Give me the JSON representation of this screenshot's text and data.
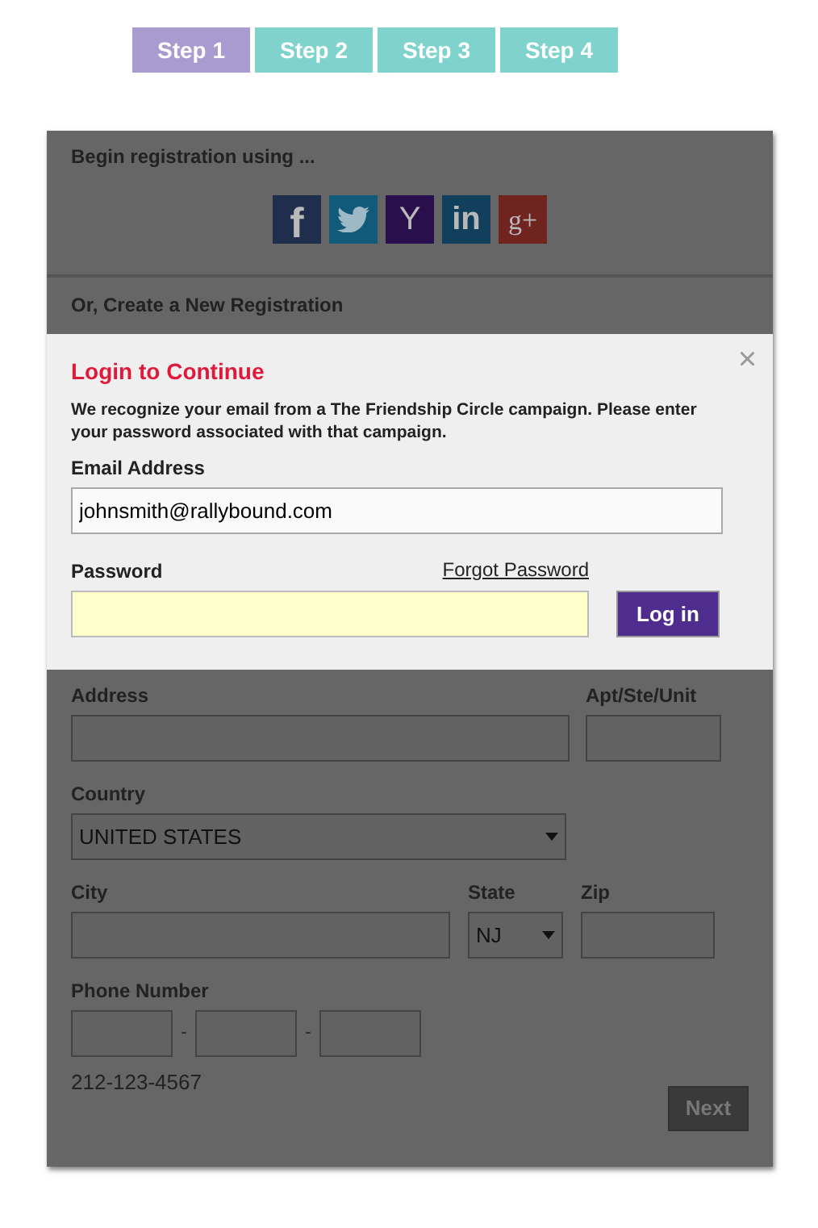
{
  "steps": [
    {
      "label": "Step 1",
      "selected": true
    },
    {
      "label": "Step 2",
      "selected": false
    },
    {
      "label": "Step 3",
      "selected": false
    },
    {
      "label": "Step 4",
      "selected": false
    }
  ],
  "social": {
    "heading": "Begin registration using ...",
    "buttons": [
      {
        "kind": "facebook",
        "label": "f"
      },
      {
        "kind": "twitter"
      },
      {
        "kind": "yahoo",
        "label": "Y"
      },
      {
        "kind": "linkedin",
        "label": "in"
      },
      {
        "kind": "google",
        "label": "g+"
      }
    ]
  },
  "new_registration_heading": "Or, Create a New Registration",
  "login_dialog": {
    "title": "Login to Continue",
    "close": "×",
    "message": "We recognize your email from a The Friendship Circle campaign. Please enter your password associated with that campaign.",
    "email_label": "Email Address",
    "email_value": "johnsmith@rallybound.com",
    "password_label": "Password",
    "forgot_link": "Forgot Password",
    "login_button": "Log in"
  },
  "form": {
    "address_label": "Address",
    "apt_label": "Apt/Ste/Unit",
    "country_label": "Country",
    "country_value": "UNITED STATES",
    "city_label": "City",
    "state_label": "State",
    "state_value": "NJ",
    "zip_label": "Zip",
    "phone_label": "Phone Number",
    "phone_separators": [
      "-",
      "-"
    ],
    "phone_hint": "212-123-4567",
    "next_button": "Next"
  }
}
